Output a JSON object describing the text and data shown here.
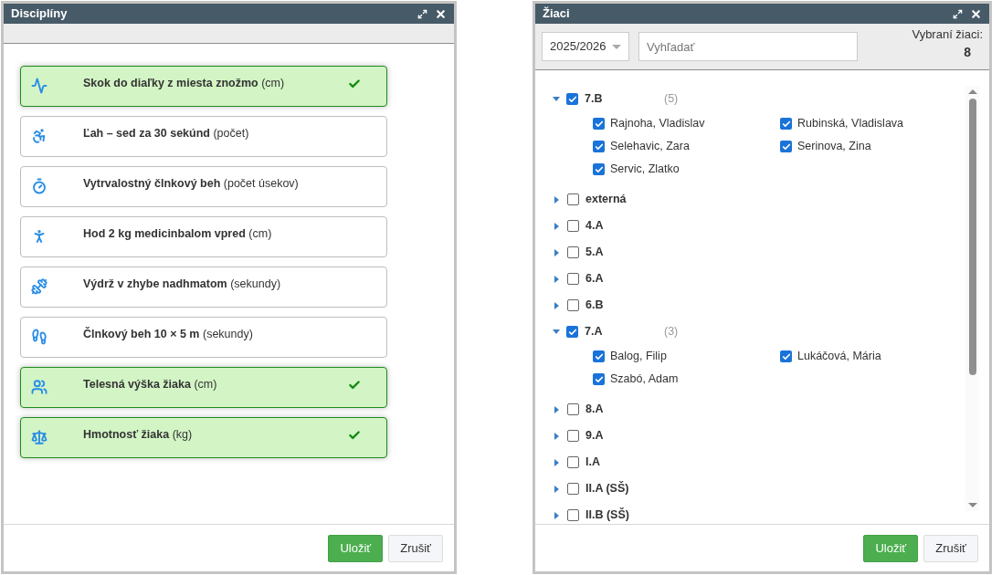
{
  "disciplines_window": {
    "title": "Disciplíny",
    "items": [
      {
        "name": "Skok do diaľky z miesta znožmo",
        "unit": "(cm)",
        "selected": true
      },
      {
        "name": "Ľah – sed za 30 sekúnd",
        "unit": "(počet)",
        "selected": false
      },
      {
        "name": "Vytrvalostný člnkový beh",
        "unit": "(počet úsekov)",
        "selected": false
      },
      {
        "name": "Hod 2 kg medicinbalom vpred",
        "unit": "(cm)",
        "selected": false
      },
      {
        "name": "Výdrž v zhybe nadhmatom",
        "unit": "(sekundy)",
        "selected": false
      },
      {
        "name": "Člnkový beh 10 × 5 m",
        "unit": "(sekundy)",
        "selected": false
      },
      {
        "name": "Telesná výška žiaka",
        "unit": "(cm)",
        "selected": true
      },
      {
        "name": "Hmotnosť žiaka",
        "unit": "(kg)",
        "selected": true
      }
    ],
    "buttons": [
      "Uložiť",
      "Zrušiť"
    ]
  },
  "students_window": {
    "title": "Žiaci",
    "year_select": "2025/2026",
    "search": {
      "placeholder": "Vyhľadať"
    },
    "selected_label": "Vybraní žiaci:",
    "selected_count": "8",
    "tree": [
      {
        "name": "7.B",
        "count": "(5)",
        "expanded": true,
        "checked": true,
        "children": [
          {
            "name": "Rajnoha, Vladislav",
            "checked": true
          },
          {
            "name": "Rubinská, Vladislava",
            "checked": true
          },
          {
            "name": "Selehavic, Zara",
            "checked": true
          },
          {
            "name": "Serinova, Zina",
            "checked": true
          },
          {
            "name": "Servic, Zlatko",
            "checked": true
          }
        ]
      },
      {
        "name": "externá",
        "expanded": false,
        "checked": false
      },
      {
        "name": "4.A",
        "expanded": false,
        "checked": false
      },
      {
        "name": "5.A",
        "expanded": false,
        "checked": false
      },
      {
        "name": "6.A",
        "expanded": false,
        "checked": false
      },
      {
        "name": "6.B",
        "expanded": false,
        "checked": false
      },
      {
        "name": "7.A",
        "count": "(3)",
        "expanded": true,
        "checked": true,
        "children": [
          {
            "name": "Balog, Filip",
            "checked": true
          },
          {
            "name": "Lukáčová, Mária",
            "checked": true
          },
          {
            "name": "Szabó, Adam",
            "checked": true
          }
        ]
      },
      {
        "name": "8.A",
        "expanded": false,
        "checked": false
      },
      {
        "name": "9.A",
        "expanded": false,
        "checked": false
      },
      {
        "name": "I.A",
        "expanded": false,
        "checked": false
      },
      {
        "name": "II.A (SŠ)",
        "expanded": false,
        "checked": false
      },
      {
        "name": "II.B (SŠ)",
        "expanded": false,
        "checked": false
      }
    ],
    "buttons": [
      "Uložiť",
      "Zrušiť"
    ]
  }
}
